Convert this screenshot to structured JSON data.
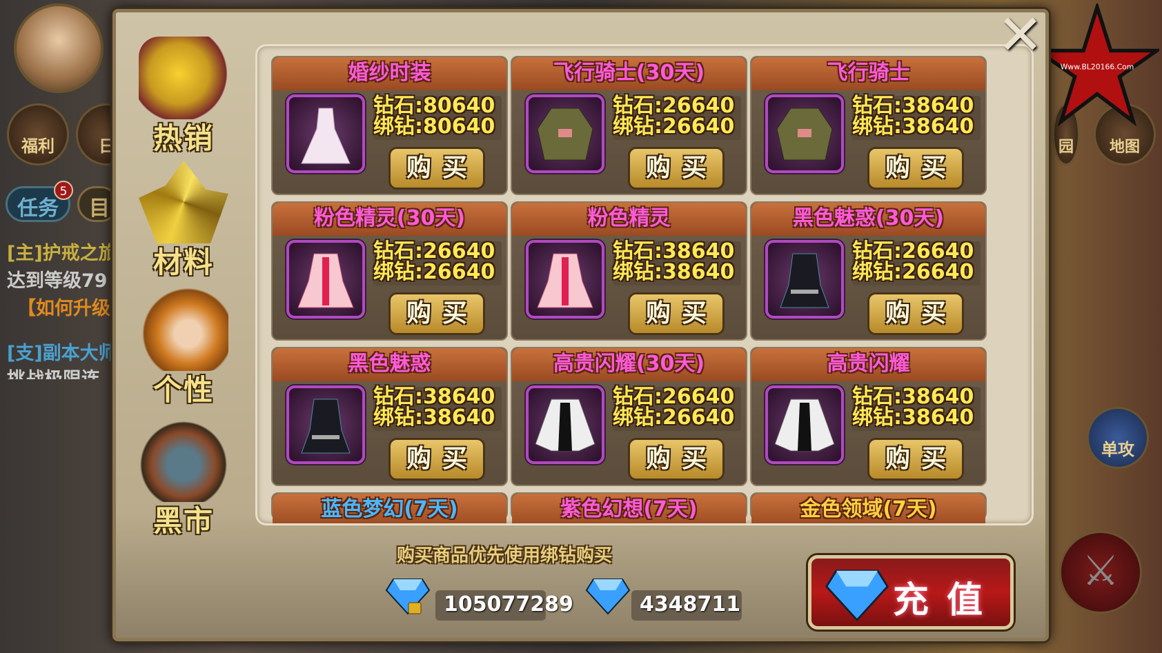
{
  "hud": {
    "welfare": "福利",
    "daily": "日",
    "task_tab": "任务",
    "task_badge": "5",
    "goal_tab": "目",
    "quest_main": "[主]护戒之旅",
    "quest_main_desc": "达到等级79",
    "quest_main_link": "【如何升级】",
    "quest_side": "[支]副本大师",
    "quest_side_desc": "挑战极限连",
    "right_garden": "园",
    "right_map": "地图",
    "right_solo": "单攻",
    "watermark": "Www.BL20166.Com"
  },
  "shop": {
    "tabs": [
      {
        "label": "热销"
      },
      {
        "label": "材料"
      },
      {
        "label": "个性"
      },
      {
        "label": "黑市"
      }
    ],
    "price_prefix_diamond": "钻石:",
    "price_prefix_bound": "绑钻:",
    "buy_label": "购买",
    "items": [
      {
        "name": "婚纱时装",
        "diamond": "钻石:80640",
        "bound": "绑钻:80640",
        "kind": "dress",
        "color": "#ff5ad8"
      },
      {
        "name": "飞行骑士(30天)",
        "diamond": "钻石:26640",
        "bound": "绑钻:26640",
        "kind": "jacket",
        "color": "#ff5ad8"
      },
      {
        "name": "飞行骑士",
        "diamond": "钻石:38640",
        "bound": "绑钻:38640",
        "kind": "jacket",
        "color": "#ff5ad8"
      },
      {
        "name": "粉色精灵(30天)",
        "diamond": "钻石:26640",
        "bound": "绑钻:26640",
        "kind": "pink",
        "color": "#ff5ad8"
      },
      {
        "name": "粉色精灵",
        "diamond": "钻石:38640",
        "bound": "绑钻:38640",
        "kind": "pink",
        "color": "#ff5ad8"
      },
      {
        "name": "黑色魅惑(30天)",
        "diamond": "钻石:26640",
        "bound": "绑钻:26640",
        "kind": "black",
        "color": "#ff5ad8"
      },
      {
        "name": "黑色魅惑",
        "diamond": "钻石:38640",
        "bound": "绑钻:38640",
        "kind": "black",
        "color": "#ff5ad8"
      },
      {
        "name": "高贵闪耀(30天)",
        "diamond": "钻石:26640",
        "bound": "绑钻:26640",
        "kind": "white",
        "color": "#ff5ad8"
      },
      {
        "name": "高贵闪耀",
        "diamond": "钻石:38640",
        "bound": "绑钻:38640",
        "kind": "white",
        "color": "#ff5ad8"
      }
    ],
    "partial_items": [
      {
        "name": "蓝色梦幻(7天)",
        "color": "#4ab8ff"
      },
      {
        "name": "紫色幻想(7天)",
        "color": "#ff5ad8"
      },
      {
        "name": "金色领域(7天)",
        "color": "#ffd040"
      }
    ],
    "note": "购买商品优先使用绑钻购买",
    "bound_diamonds": "105077289",
    "diamonds": "4348711",
    "recharge_label": "充值"
  }
}
